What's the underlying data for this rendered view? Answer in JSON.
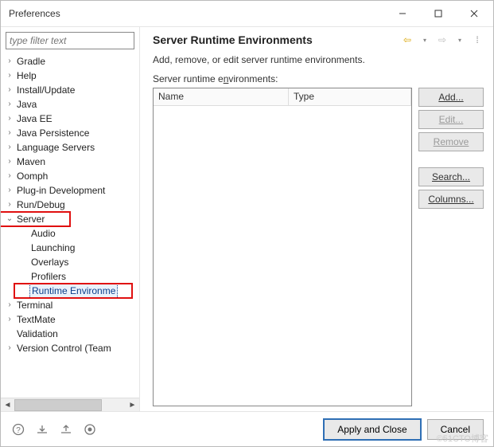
{
  "window": {
    "title": "Preferences"
  },
  "filter": {
    "placeholder": "type filter text"
  },
  "tree": {
    "items": [
      {
        "label": "Gradle",
        "depth": 1,
        "expandable": true,
        "expanded": false
      },
      {
        "label": "Help",
        "depth": 1,
        "expandable": true,
        "expanded": false
      },
      {
        "label": "Install/Update",
        "depth": 1,
        "expandable": true,
        "expanded": false
      },
      {
        "label": "Java",
        "depth": 1,
        "expandable": true,
        "expanded": false
      },
      {
        "label": "Java EE",
        "depth": 1,
        "expandable": true,
        "expanded": false
      },
      {
        "label": "Java Persistence",
        "depth": 1,
        "expandable": true,
        "expanded": false
      },
      {
        "label": "Language Servers",
        "depth": 1,
        "expandable": true,
        "expanded": false
      },
      {
        "label": "Maven",
        "depth": 1,
        "expandable": true,
        "expanded": false
      },
      {
        "label": "Oomph",
        "depth": 1,
        "expandable": true,
        "expanded": false
      },
      {
        "label": "Plug-in Development",
        "depth": 1,
        "expandable": true,
        "expanded": false
      },
      {
        "label": "Run/Debug",
        "depth": 1,
        "expandable": true,
        "expanded": false
      },
      {
        "label": "Server",
        "depth": 1,
        "expandable": true,
        "expanded": true,
        "highlight": true
      },
      {
        "label": "Audio",
        "depth": 2,
        "expandable": false
      },
      {
        "label": "Launching",
        "depth": 2,
        "expandable": false
      },
      {
        "label": "Overlays",
        "depth": 2,
        "expandable": false
      },
      {
        "label": "Profilers",
        "depth": 2,
        "expandable": false
      },
      {
        "label": "Runtime Environme",
        "depth": 2,
        "expandable": false,
        "selected": true,
        "highlight": true
      },
      {
        "label": "Terminal",
        "depth": 1,
        "expandable": true,
        "expanded": false
      },
      {
        "label": "TextMate",
        "depth": 1,
        "expandable": true,
        "expanded": false
      },
      {
        "label": "Validation",
        "depth": 1,
        "expandable": false
      },
      {
        "label": "Version Control (Team",
        "depth": 1,
        "expandable": true,
        "expanded": false
      }
    ]
  },
  "page": {
    "title": "Server Runtime Environments",
    "description": "Add, remove, or edit server runtime environments.",
    "list_label_pre": "Server runtime e",
    "list_label_u": "n",
    "list_label_post": "vironments:",
    "columns": {
      "name": "Name",
      "type": "Type"
    },
    "buttons": {
      "add": "Add...",
      "edit": "Edit...",
      "remove": "Remove",
      "search": "Search...",
      "columns": "Columns..."
    }
  },
  "footer": {
    "apply": "Apply and Close",
    "cancel": "Cancel"
  },
  "watermark": "©51CTO博客"
}
